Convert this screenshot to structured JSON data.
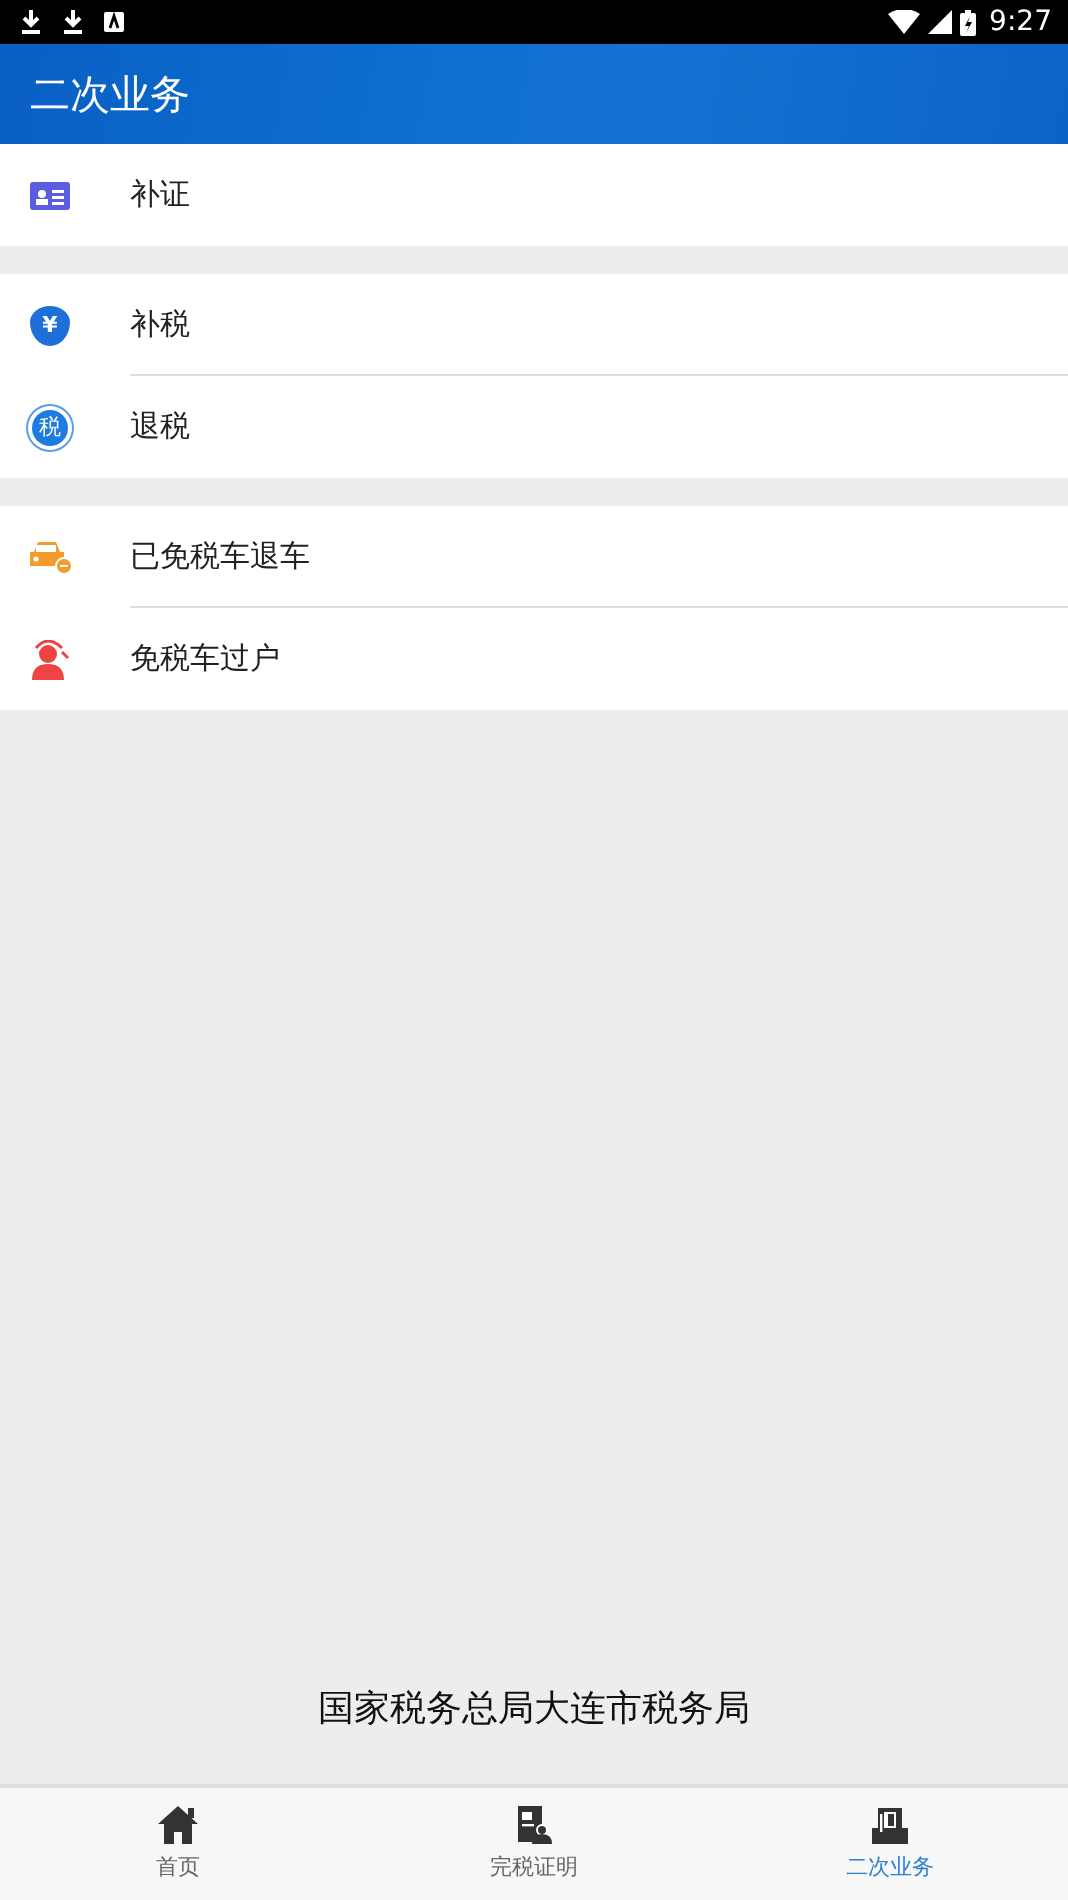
{
  "status_bar": {
    "time": "9:27"
  },
  "header": {
    "title": "二次业务"
  },
  "groups": [
    {
      "items": [
        {
          "label": "补证",
          "kind": "card"
        }
      ]
    },
    {
      "items": [
        {
          "label": "补税",
          "kind": "moneybag",
          "icon_text": "¥"
        },
        {
          "label": "退税",
          "kind": "taxbadge",
          "icon_text": "税"
        }
      ]
    },
    {
      "items": [
        {
          "label": "已免税车退车",
          "kind": "car"
        },
        {
          "label": "免税车过户",
          "kind": "person"
        }
      ]
    }
  ],
  "footer": {
    "text": "国家税务总局大连市税务局"
  },
  "bottom_nav": [
    {
      "label": "首页",
      "kind": "home",
      "selected": false
    },
    {
      "label": "完税证明",
      "kind": "certificate",
      "selected": false
    },
    {
      "label": "二次业务",
      "kind": "business",
      "selected": true
    }
  ]
}
